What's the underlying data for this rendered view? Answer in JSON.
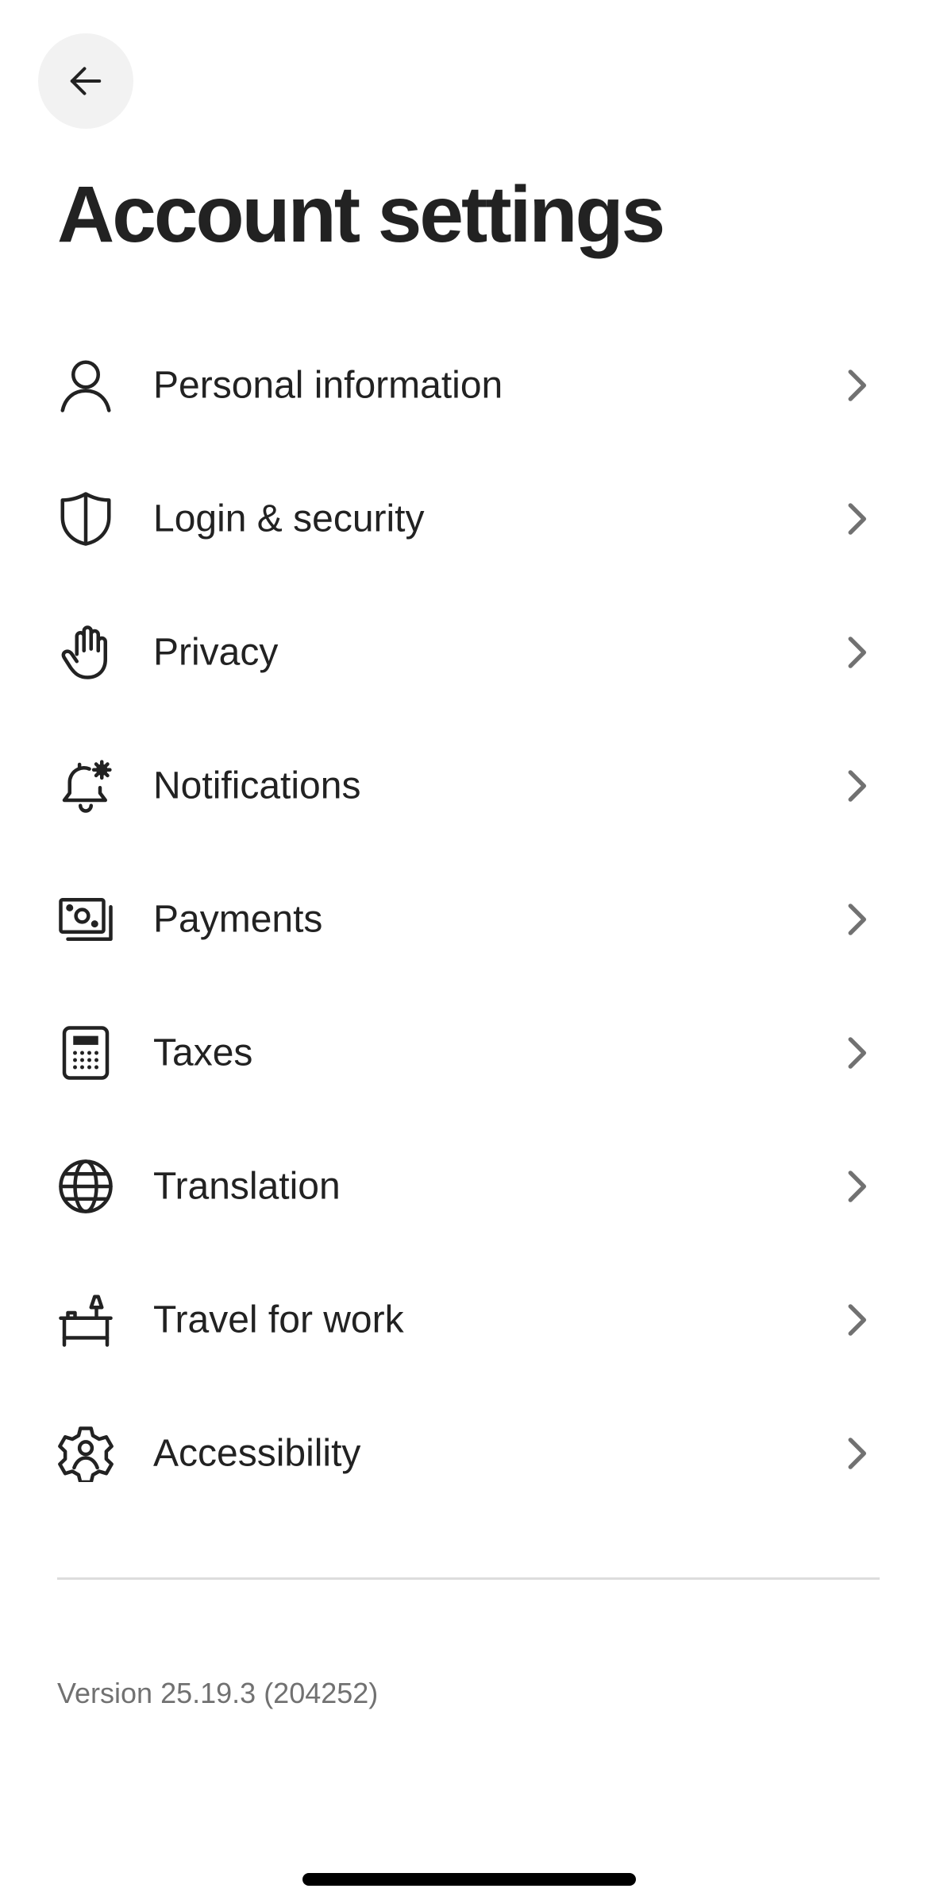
{
  "header": {
    "back_icon": "arrow-left-icon",
    "title": "Account settings"
  },
  "settings": {
    "items": [
      {
        "label": "Personal information",
        "icon": "person-icon"
      },
      {
        "label": "Login & security",
        "icon": "shield-icon"
      },
      {
        "label": "Privacy",
        "icon": "hand-icon"
      },
      {
        "label": "Notifications",
        "icon": "bell-gear-icon"
      },
      {
        "label": "Payments",
        "icon": "cash-icon"
      },
      {
        "label": "Taxes",
        "icon": "calculator-icon"
      },
      {
        "label": "Translation",
        "icon": "globe-icon"
      },
      {
        "label": "Travel for work",
        "icon": "desk-lamp-icon"
      },
      {
        "label": "Accessibility",
        "icon": "accessibility-gear-icon"
      }
    ],
    "chevron_icon": "chevron-right-icon"
  },
  "footer": {
    "version": "Version 25.19.3 (204252)"
  },
  "colors": {
    "text": "#222222",
    "secondary_text": "#717171",
    "divider": "#dddddd",
    "back_button_bg": "#f2f2f2"
  }
}
